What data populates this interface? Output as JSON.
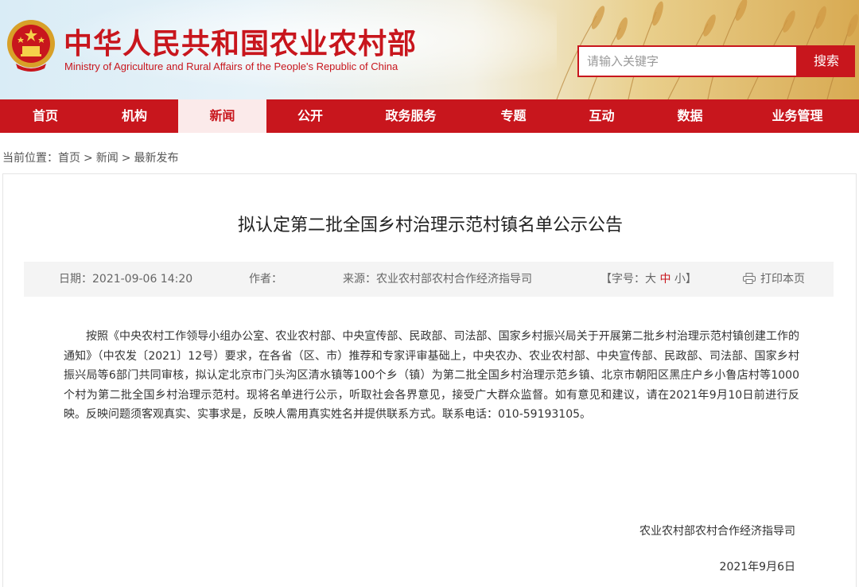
{
  "header": {
    "title_cn": "中华人民共和国农业农村部",
    "title_en": "Ministry of Agriculture and Rural Affairs of the People's Republic of China",
    "emblem_icon": "national-emblem-icon",
    "search_placeholder": "请输入关键字",
    "search_button": "搜索"
  },
  "nav": {
    "items": [
      {
        "label": "首页"
      },
      {
        "label": "机构"
      },
      {
        "label": "新闻",
        "active": true
      },
      {
        "label": "公开"
      },
      {
        "label": "政务服务"
      },
      {
        "label": "专题"
      },
      {
        "label": "互动"
      },
      {
        "label": "数据"
      },
      {
        "label": "业务管理"
      }
    ]
  },
  "breadcrumb": {
    "prefix": "当前位置：",
    "items": [
      "首页",
      "新闻",
      "最新发布"
    ],
    "separator": ">"
  },
  "article": {
    "title": "拟认定第二批全国乡村治理示范村镇名单公示公告",
    "meta": {
      "date": "日期：2021-09-06 14:20",
      "author": "作者：",
      "source": "来源：农业农村部农村合作经济指导司",
      "font_label": "【字号：",
      "font_large": "大",
      "font_medium": "中",
      "font_small": "小",
      "font_end": "】",
      "print_icon": "printer-icon",
      "print_label": "打印本页"
    },
    "body": "按照《中央农村工作领导小组办公室、农业农村部、中央宣传部、民政部、司法部、国家乡村振兴局关于开展第二批乡村治理示范村镇创建工作的通知》（中农发〔2021〕12号）要求，在各省（区、市）推荐和专家评审基础上，中央农办、农业农村部、中央宣传部、民政部、司法部、国家乡村振兴局等6部门共同审核，拟认定北京市门头沟区清水镇等100个乡（镇）为第二批全国乡村治理示范乡镇、北京市朝阳区黑庄户乡小鲁店村等1000个村为第二批全国乡村治理示范村。现将名单进行公示，听取社会各界意见，接受广大群众监督。如有意见和建议，请在2021年9月10日前进行反映。反映问题须客观真实、实事求是，反映人需用真实姓名并提供联系方式。联系电话：010-59193105。",
    "signature": "农业农村部农村合作经济指导司",
    "sign_date": "2021年9月6日"
  },
  "colors": {
    "brand_red": "#c8161d",
    "nav_active_bg": "#fbeaea",
    "meta_bg": "#f4f4f4"
  }
}
